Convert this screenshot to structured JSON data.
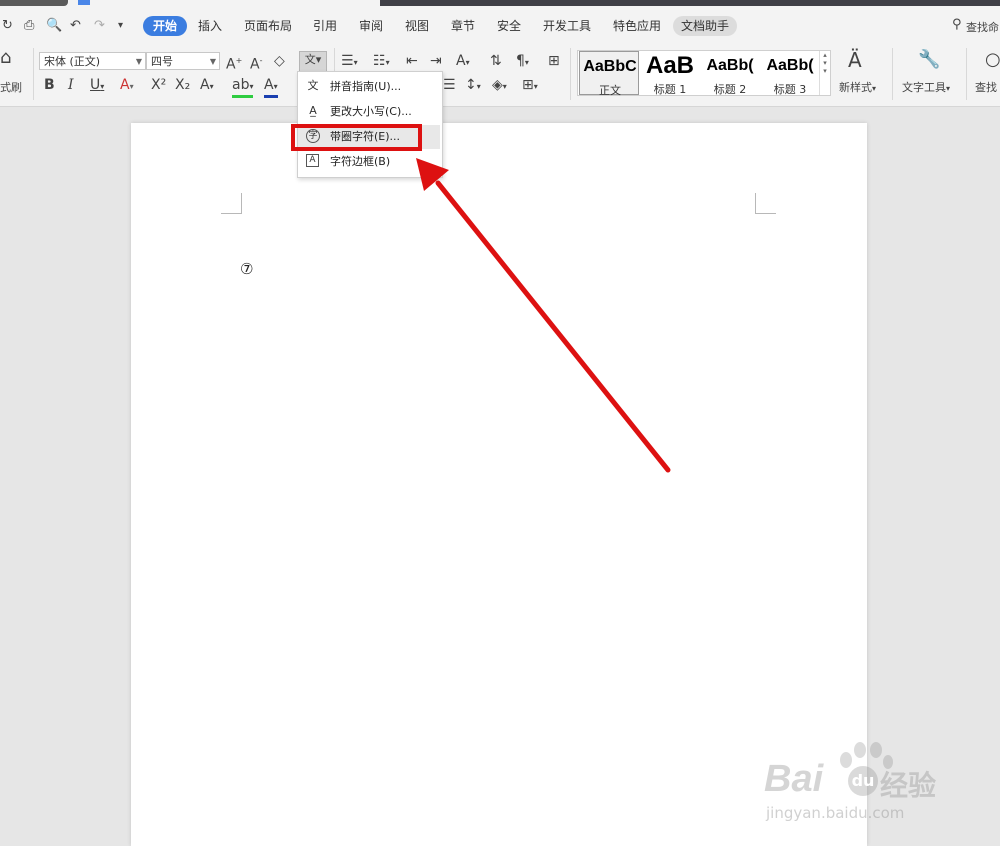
{
  "menubar": {
    "tabs": [
      "开始",
      "插入",
      "页面布局",
      "引用",
      "审阅",
      "视图",
      "章节",
      "安全",
      "开发工具",
      "特色应用",
      "文档助手"
    ],
    "search_label": "查找命"
  },
  "ribbon": {
    "format_painter": "式刷",
    "font_name": "宋体 (正文)",
    "font_size": "四号",
    "styles": [
      {
        "preview": "AaBbC",
        "name": "正文"
      },
      {
        "preview": "AaB",
        "name": "标题 1"
      },
      {
        "preview": "AaBb(",
        "name": "标题 2"
      },
      {
        "preview": "AaBb(",
        "name": "标题 3"
      }
    ],
    "new_style": "新样式",
    "text_tools": "文字工具",
    "find": "查找"
  },
  "dropdown": {
    "items": [
      "拼音指南(U)...",
      "更改大小写(C)...",
      "带圈字符(E)...",
      "字符边框(B)"
    ]
  },
  "document": {
    "content": "⑦"
  },
  "watermark": {
    "brand": "Bai",
    "brand2": "经验",
    "url": "jingyan.baidu.com"
  },
  "colors": {
    "accent": "#3b7de0",
    "highlight_box": "#dd1111",
    "arrow": "#dd1111"
  }
}
